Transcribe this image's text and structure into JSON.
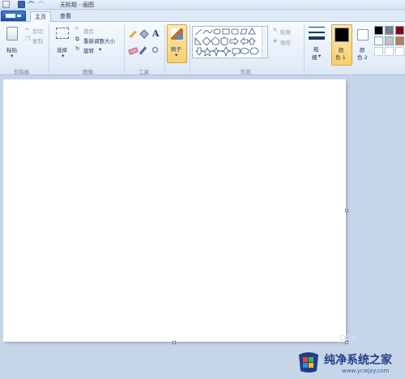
{
  "window": {
    "title": "无标题 - 画图"
  },
  "tabs": [
    {
      "label": "主页",
      "active": true
    },
    {
      "label": "查看",
      "active": false
    }
  ],
  "clipboard": {
    "paste": "粘贴",
    "cut": "剪切",
    "copy": "复制",
    "group": "剪贴板"
  },
  "image": {
    "select": "选择",
    "crop": "裁剪",
    "resize": "重新调整大小",
    "rotate": "旋转",
    "group": "图像"
  },
  "tools": {
    "group": "工具"
  },
  "brushes": {
    "label": "刷子"
  },
  "shapes": {
    "outline": "轮廓",
    "fill": "填充",
    "group": "形状"
  },
  "size": {
    "label_line1": "粗",
    "label_line2": "细"
  },
  "colors": {
    "color1_line1": "颜",
    "color1_line2": "色 1",
    "color2_line1": "颜",
    "color2_line2": "色 2",
    "color1_value": "#000000",
    "color2_value": "#ffffff",
    "palette": [
      "#000000",
      "#7f7f7f",
      "#880015",
      "#ffffff",
      "#c3c3c3",
      "#b97a57",
      "#ffffff",
      "#ffffff",
      "#ffffff"
    ]
  },
  "watermark": {
    "brand": "纯净系统之家",
    "url": "www.ycwjzy.com"
  }
}
